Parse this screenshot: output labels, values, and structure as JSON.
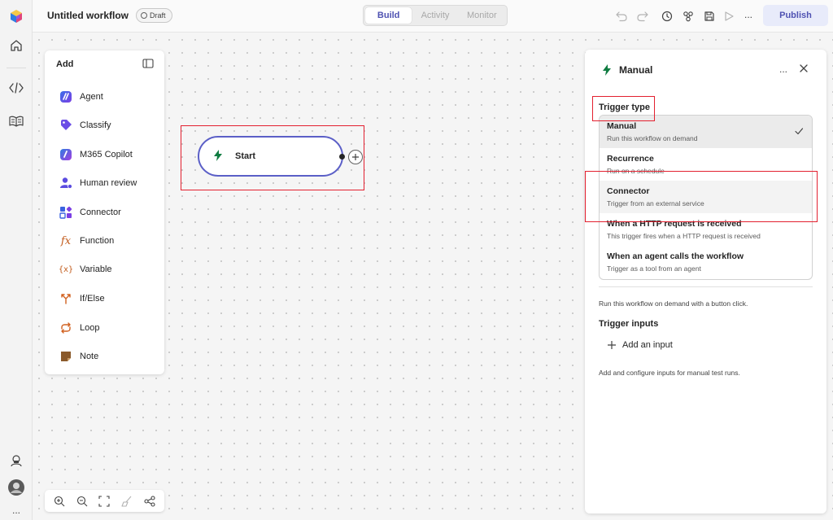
{
  "app": {
    "colors": {
      "accent": "#5b5fc7",
      "accent_text": "#4f52b2",
      "highlight": "#e3202f",
      "trigger_green": "#107c41"
    }
  },
  "rail": {
    "items": [
      {
        "name": "app-logo-icon"
      },
      {
        "name": "home-icon"
      },
      {
        "name": "code-icon"
      },
      {
        "name": "library-icon"
      },
      {
        "name": "support-icon"
      },
      {
        "name": "avatar"
      },
      {
        "name": "more-icon",
        "label": "..."
      }
    ]
  },
  "header": {
    "title": "Untitled workflow",
    "status": "Draft",
    "tabs": [
      {
        "label": "Build",
        "active": true
      },
      {
        "label": "Activity",
        "active": false
      },
      {
        "label": "Monitor",
        "active": false
      }
    ],
    "more_label": "...",
    "publish_label": "Publish"
  },
  "add_panel": {
    "title": "Add",
    "items": [
      {
        "label": "Agent",
        "icon": "agent-icon"
      },
      {
        "label": "Classify",
        "icon": "classify-icon"
      },
      {
        "label": "M365 Copilot",
        "icon": "copilot-icon"
      },
      {
        "label": "Human review",
        "icon": "human-review-icon"
      },
      {
        "label": "Connector",
        "icon": "connector-icon"
      },
      {
        "label": "Function",
        "icon": "function-icon",
        "glyph": "fx"
      },
      {
        "label": "Variable",
        "icon": "variable-icon",
        "glyph": "{x}"
      },
      {
        "label": "If/Else",
        "icon": "if-else-icon"
      },
      {
        "label": "Loop",
        "icon": "loop-icon"
      },
      {
        "label": "Note",
        "icon": "note-icon"
      }
    ]
  },
  "canvas": {
    "start_node": {
      "label": "Start",
      "icon": "lightning-icon"
    },
    "zoom_tools": [
      "zoom-in-icon",
      "zoom-out-icon",
      "fit-view-icon",
      "clean-up-icon",
      "layout-icon"
    ]
  },
  "properties": {
    "title": "Manual",
    "more_label": "...",
    "trigger_type_label": "Trigger type",
    "options": [
      {
        "title": "Manual",
        "desc": "Run this workflow on demand",
        "selected": true
      },
      {
        "title": "Recurrence",
        "desc": "Run on a schedule",
        "selected": false
      },
      {
        "title": "Connector",
        "desc": "Trigger from an external service",
        "selected": false
      },
      {
        "title": "When a HTTP request is received",
        "desc": "This trigger fires when a HTTP request is received",
        "selected": false
      },
      {
        "title": "When an agent calls the workflow",
        "desc": "Trigger as a tool from an agent",
        "selected": false
      }
    ],
    "description": "Run this workflow on demand with a button click.",
    "inputs_label": "Trigger inputs",
    "add_input_label": "Add an input",
    "inputs_help": "Add and configure inputs for manual test runs."
  }
}
